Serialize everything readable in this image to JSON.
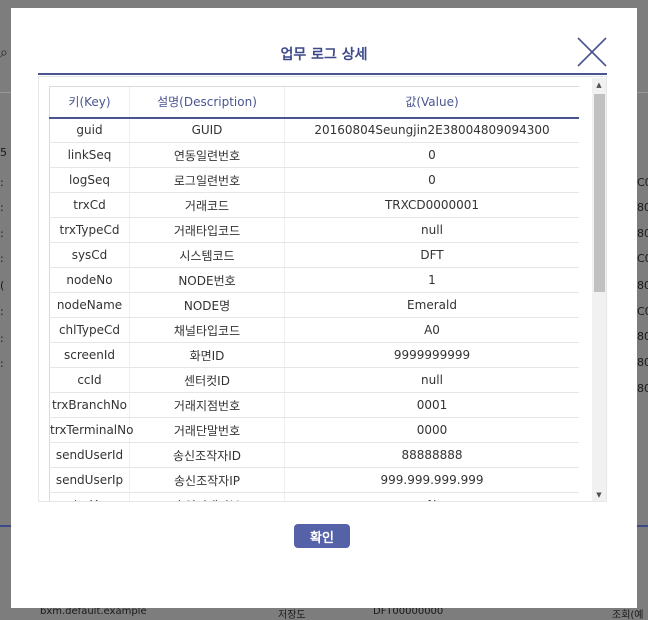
{
  "background": {
    "right_fragments": [
      "C0",
      "80",
      "80",
      "C0",
      "80",
      "C0",
      "80",
      "80",
      "80"
    ],
    "left_fragments": [
      "Q",
      "5",
      ":",
      ":",
      ":",
      ":",
      "(",
      ":",
      ":",
      ":"
    ],
    "bottom_text": "bxm.default.example",
    "bottom_button": "저장도",
    "bottom_value": "DFT00000000",
    "bottom_right": "조회(예"
  },
  "modal": {
    "title": "업무 로그 상세",
    "close_icon": "close-x-icon",
    "confirm_label": "확인"
  },
  "table": {
    "headers": [
      "키(Key)",
      "설명(Description)",
      "값(Value)"
    ],
    "rows": [
      [
        "guid",
        "GUID",
        "20160804Seungjin2E38004809094300"
      ],
      [
        "linkSeq",
        "연동일련번호",
        "0"
      ],
      [
        "logSeq",
        "로그일련번호",
        "0"
      ],
      [
        "trxCd",
        "거래코드",
        "TRXCD0000001"
      ],
      [
        "trxTypeCd",
        "거래타입코드",
        "null"
      ],
      [
        "sysCd",
        "시스템코드",
        "DFT"
      ],
      [
        "nodeNo",
        "NODE번호",
        "1"
      ],
      [
        "nodeName",
        "NODE명",
        "Emerald"
      ],
      [
        "chlTypeCd",
        "채널타입코드",
        "A0"
      ],
      [
        "screenId",
        "화면ID",
        "9999999999"
      ],
      [
        "ccId",
        "센터컷ID",
        "null"
      ],
      [
        "trxBranchNo",
        "거래지점번호",
        "0001"
      ],
      [
        "trxTerminalNo",
        "거래단말번호",
        "0000"
      ],
      [
        "sendUserId",
        "송신조작자ID",
        "88888888"
      ],
      [
        "sendUserIp",
        "송신조작자IP",
        "999.999.999.999"
      ],
      [
        "trxYn",
        "승인거래여부",
        "N"
      ]
    ]
  },
  "colors": {
    "accent": "#4a5590",
    "button": "#5562a8",
    "overlay": "#7d7d7d"
  }
}
